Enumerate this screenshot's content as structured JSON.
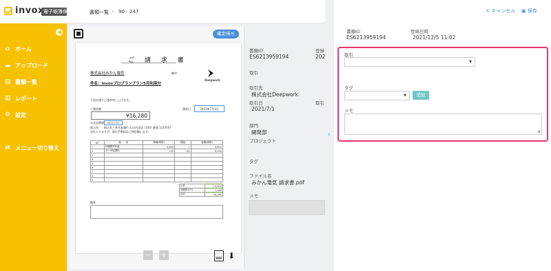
{
  "app": {
    "logo": "invox",
    "logo_sub": "電子帳簿保存"
  },
  "sidebar": {
    "items": [
      {
        "label": "ホーム",
        "icon": "home-icon"
      },
      {
        "label": "アップロード",
        "icon": "cloud-upload-icon"
      },
      {
        "label": "書類一覧",
        "icon": "document-icon"
      },
      {
        "label": "レポート",
        "icon": "chart-icon"
      },
      {
        "label": "設定",
        "icon": "gear-icon"
      }
    ],
    "menu_toggle": "メニュー切り替え"
  },
  "breadcrumb": {
    "list": "書類一覧",
    "current": "90",
    "total": "247"
  },
  "viewer": {
    "badge": "確定待ち",
    "document": {
      "title": "ご 請 求 書",
      "to": "株式会社みかん電気",
      "to_suffix": "御中",
      "subject": "件名：invoxプロプランプラン5月利用分",
      "company": "Deepwork",
      "greeting": "下記の通りご請求申し上げます。",
      "amount_label": "ご請求額",
      "amount": "¥16,280",
      "issue_label": "請求日",
      "issue_date": "2021年7月1日",
      "due_label": "お支払期限",
      "due_date": "2021/7/31",
      "bank_label": "振込先",
      "bank": "振込先三井住友銀行 丸の内支店 (100) 普通 1234567",
      "note_line": "恐れ入りますが、振込手数料はご負担願います。",
      "table_header": [
        "NO",
        "品　　目",
        "単価(税抜)",
        "数量",
        "金額(税抜)"
      ],
      "rows": [
        [
          "1",
          "月額基本料金",
          "8,800",
          "1",
          "8,800"
        ],
        [
          "2",
          "データ処理料",
          "100",
          "60",
          "6,000"
        ]
      ],
      "totals": [
        [
          "小計",
          "14,800"
        ],
        [
          "消費税10%",
          "1,480"
        ],
        [
          "合計",
          "16,280"
        ]
      ],
      "remarks_label": "備考"
    }
  },
  "info": {
    "doc_id_label": "書類ID",
    "doc_id": "ES6213959194",
    "reg_label": "登録",
    "reg_value": "202",
    "deal_label": "取引",
    "partner_label": "取引先",
    "partner": "株式会社Deepwork",
    "deal_date_label": "取引日",
    "deal_date": "2021/7/1",
    "deal_amount_label": "取引",
    "dept_label": "部門",
    "dept": "開発部",
    "project_label": "プロジェクト",
    "tag_label": "タグ",
    "file_label": "ファイル名",
    "file": "みかん電気 請求書.pdf",
    "memo_label": "メモ"
  },
  "panel": {
    "cancel": "キャンセル",
    "save": "保存",
    "doc_id_label": "書類ID",
    "doc_id": "ES6213959194",
    "reg_date_label": "登録日時",
    "reg_date": "2021/12/5 11:02",
    "deal_label": "取引",
    "tag_label": "タグ",
    "add_button": "追加",
    "memo_label": "メモ"
  }
}
